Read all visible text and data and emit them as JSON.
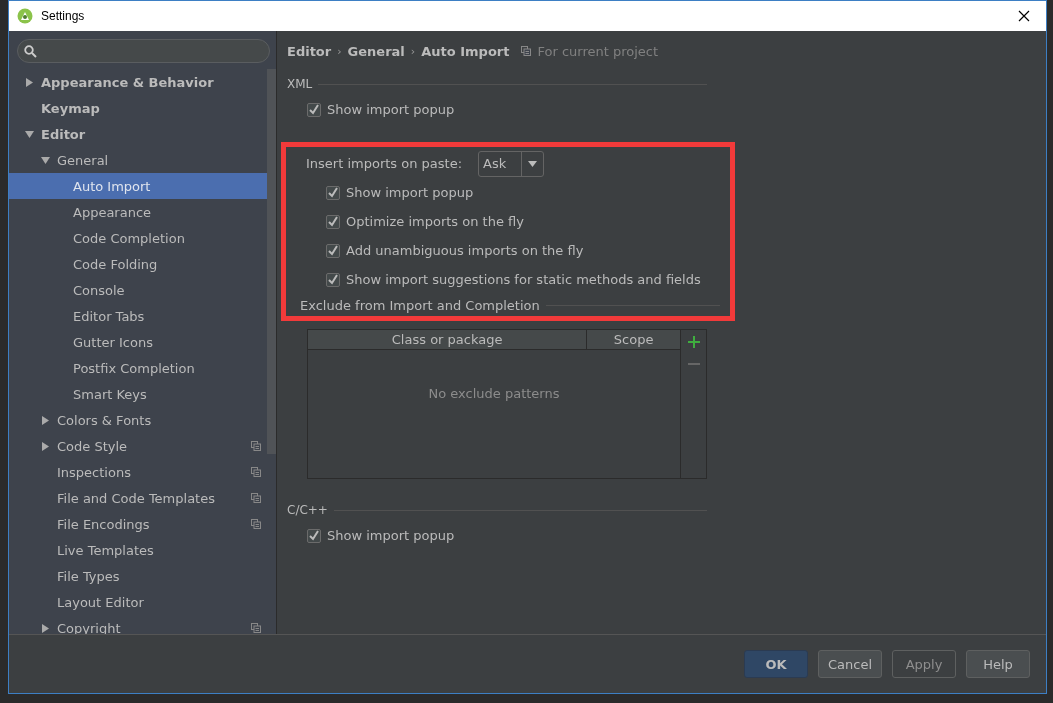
{
  "window": {
    "title": "Settings"
  },
  "sidebar": {
    "items": [
      {
        "label": "Appearance & Behavior",
        "bold": true,
        "expanded": false,
        "selected": false,
        "project": false
      },
      {
        "label": "Keymap",
        "bold": true,
        "selected": false,
        "project": false
      },
      {
        "label": "Editor",
        "bold": true,
        "expanded": true,
        "selected": false,
        "project": false,
        "children": [
          {
            "label": "General",
            "bold": false,
            "expanded": true,
            "selected": false,
            "project": false,
            "children": [
              {
                "label": "Auto Import",
                "bold": false,
                "selected": true,
                "project": false
              },
              {
                "label": "Appearance",
                "bold": false,
                "selected": false,
                "project": false
              },
              {
                "label": "Code Completion",
                "bold": false,
                "selected": false,
                "project": false
              },
              {
                "label": "Code Folding",
                "bold": false,
                "selected": false,
                "project": false
              },
              {
                "label": "Console",
                "bold": false,
                "selected": false,
                "project": false
              },
              {
                "label": "Editor Tabs",
                "bold": false,
                "selected": false,
                "project": false
              },
              {
                "label": "Gutter Icons",
                "bold": false,
                "selected": false,
                "project": false
              },
              {
                "label": "Postfix Completion",
                "bold": false,
                "selected": false,
                "project": false
              },
              {
                "label": "Smart Keys",
                "bold": false,
                "selected": false,
                "project": false
              }
            ]
          },
          {
            "label": "Colors & Fonts",
            "bold": false,
            "expanded": false,
            "selected": false,
            "project": false
          },
          {
            "label": "Code Style",
            "bold": false,
            "expanded": false,
            "selected": false,
            "project": true
          },
          {
            "label": "Inspections",
            "bold": false,
            "selected": false,
            "project": true
          },
          {
            "label": "File and Code Templates",
            "bold": false,
            "selected": false,
            "project": true
          },
          {
            "label": "File Encodings",
            "bold": false,
            "selected": false,
            "project": true
          },
          {
            "label": "Live Templates",
            "bold": false,
            "selected": false,
            "project": false
          },
          {
            "label": "File Types",
            "bold": false,
            "selected": false,
            "project": false
          },
          {
            "label": "Layout Editor",
            "bold": false,
            "selected": false,
            "project": false
          },
          {
            "label": "Copyright",
            "bold": false,
            "expanded": false,
            "selected": false,
            "project": true
          }
        ]
      }
    ]
  },
  "breadcrumb": {
    "parts": [
      "Editor",
      "General",
      "Auto Import"
    ],
    "separator": "›",
    "scope": "For current project"
  },
  "groups": [
    {
      "title": "XML",
      "highlighted": false,
      "rows": [
        {
          "kind": "checkbox",
          "label": "Show import popup",
          "checked": true
        }
      ]
    },
    {
      "highlighted": true,
      "rows": [
        {
          "kind": "select",
          "label": "Insert imports on paste:",
          "value": "Ask"
        },
        {
          "kind": "checkbox",
          "label": "Show import popup",
          "checked": true
        },
        {
          "kind": "checkbox",
          "label": "Optimize imports on the fly",
          "checked": true
        },
        {
          "kind": "checkbox",
          "label": "Add unambiguous imports on the fly",
          "checked": true
        },
        {
          "kind": "checkbox",
          "label": "Show import suggestions for static methods and fields",
          "checked": true
        },
        {
          "kind": "subheading",
          "label": "Exclude from Import and Completion"
        }
      ]
    },
    {
      "kind": "table",
      "columns": [
        "Class or package",
        "Scope"
      ],
      "empty_text": "No exclude patterns"
    },
    {
      "title": "C/C++",
      "highlighted": false,
      "rows": [
        {
          "kind": "checkbox",
          "label": "Show import popup",
          "checked": true
        }
      ]
    }
  ],
  "buttons": [
    {
      "label": "OK",
      "default": true,
      "disabled": false
    },
    {
      "label": "Cancel",
      "default": false,
      "disabled": false
    },
    {
      "label": "Apply",
      "default": false,
      "disabled": true
    },
    {
      "label": "Help",
      "default": false,
      "disabled": false
    }
  ]
}
